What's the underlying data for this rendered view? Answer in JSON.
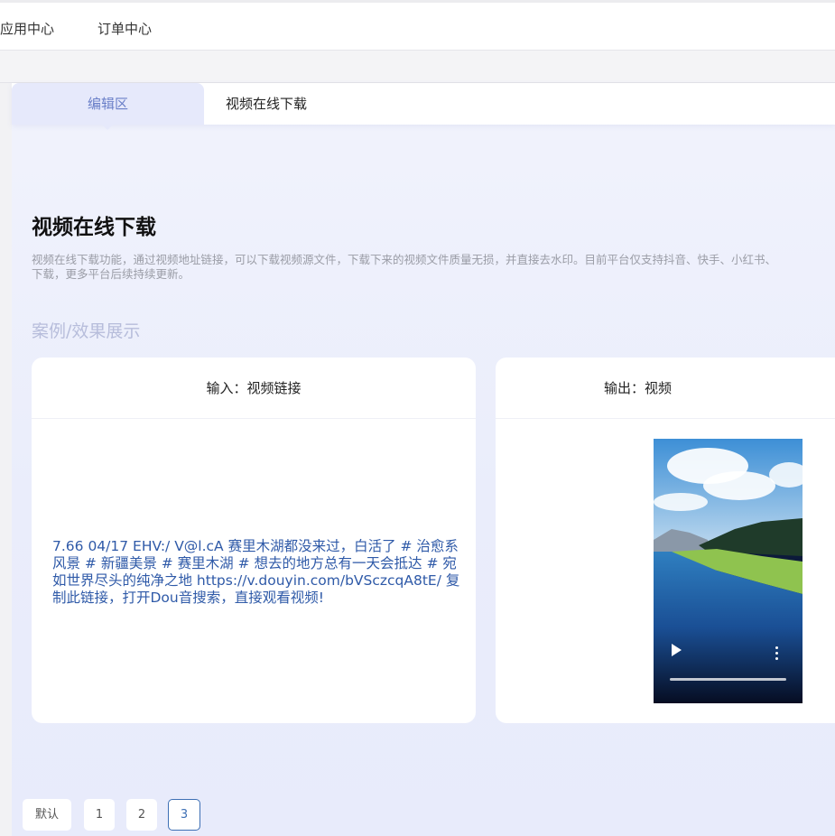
{
  "topnav": {
    "items": [
      {
        "label": "应用中心"
      },
      {
        "label": "订单中心"
      }
    ]
  },
  "tabs": [
    {
      "label": "编辑区"
    },
    {
      "label": "视频在线下载"
    }
  ],
  "page": {
    "title": "视频在线下载",
    "description_line1": "视频在线下载功能，通过视频地址链接，可以下载视频源文件，下载下来的视频文件质量无损，并直接去水印。目前平台仅支持抖音、快手、小红书、",
    "description_line2": "下载，更多平台后续持续更新。",
    "section_title": "案例/效果展示"
  },
  "input_card": {
    "header": "输入：视频链接",
    "link_text": "7.66 04/17 EHV:/ V@l.cA 赛里木湖都没来过，白活了 # 治愈系风景 # 新疆美景 # 赛里木湖 # 想去的地方总有一天会抵达 # 宛如世界尽头的纯净之地 https://v.douyin.com/bVSczcqA8tE/ 复制此链接，打开Dou音搜索，直接观看视频!"
  },
  "output_card": {
    "header": "输出：视频",
    "video": {
      "progress": 0.0
    }
  },
  "pagination": {
    "default_label": "默认",
    "pages": [
      "1",
      "2",
      "3"
    ],
    "current": "3"
  },
  "colors": {
    "accent": "#6a7fc8",
    "link": "#2f5aa8",
    "active_page_border": "#3d6fb4",
    "section_title": "#b7bddb"
  }
}
